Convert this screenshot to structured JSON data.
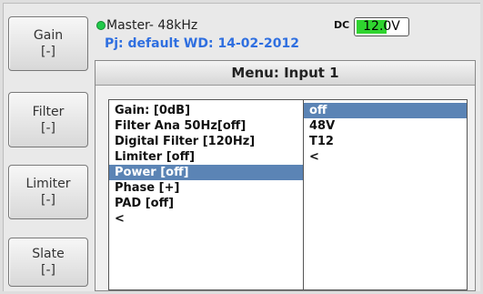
{
  "side_buttons": [
    {
      "label": "Gain",
      "sub": "[-]"
    },
    {
      "label": "Filter",
      "sub": "[-]"
    },
    {
      "label": "Limiter",
      "sub": "[-]"
    },
    {
      "label": "Slate",
      "sub": "[-]"
    }
  ],
  "status": {
    "master": "Master- 48kHz",
    "project": "Pj: default  WD: 14-02-2012",
    "dc_label": "DC",
    "dc_value_highlight": "12.0",
    "dc_value_unit": "V",
    "dc_level_fraction": 0.6,
    "led_color": "#21c94a"
  },
  "menu": {
    "title": "Menu: Input 1",
    "settings": [
      "Gain: [0dB]",
      "Filter Ana 50Hz[off]",
      "Digital Filter [120Hz]",
      "Limiter [off]",
      "Power [off]",
      "Phase [+]",
      "PAD [off]",
      "<"
    ],
    "settings_selected_index": 4,
    "values": [
      "off",
      "48V",
      "T12",
      "<"
    ],
    "values_selected_index": 0,
    "selection_color": "#5b84b5"
  }
}
